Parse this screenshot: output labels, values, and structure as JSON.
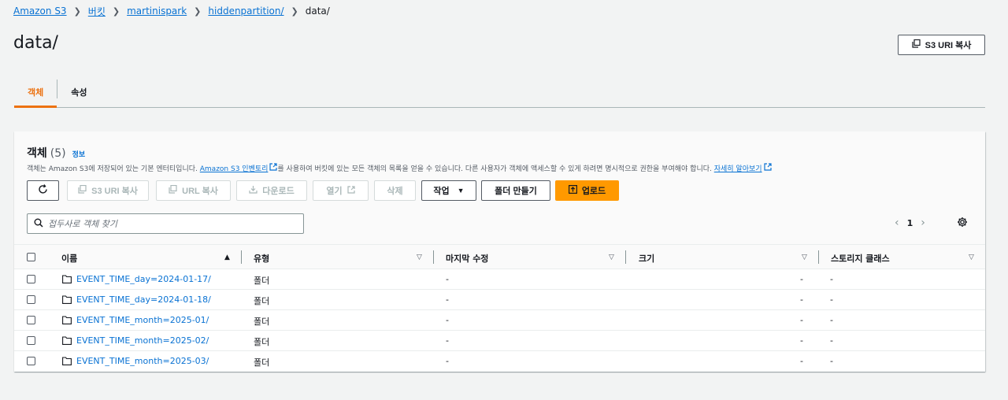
{
  "breadcrumb": [
    {
      "label": "Amazon S3"
    },
    {
      "label": "버킷"
    },
    {
      "label": "martinispark"
    },
    {
      "label": "hiddenpartition/"
    }
  ],
  "breadcrumb_current": "data/",
  "title": "data/",
  "copy_uri_top": "S3 URI 복사",
  "tabs": [
    {
      "label": "객체",
      "active": true
    },
    {
      "label": "속성",
      "active": false
    }
  ],
  "panel": {
    "title": "객체",
    "count": "(5)",
    "info": "정보",
    "desc_1": "객체는 Amazon S3에 저장되어 있는 기본 엔터티입니다. ",
    "desc_link1": "Amazon S3 인벤토리",
    "desc_2": "를 사용하여 버킷에 있는 모든 객체의 목록을 얻을 수 있습니다. 다른 사용자가 객체에 액세스할 수 있게 하려면 명시적으로 권한을 부여해야 합니다. ",
    "desc_link2": "자세히 알아보기"
  },
  "toolbar": {
    "copy_s3_uri": "S3 URI 복사",
    "copy_url": "URL 복사",
    "download": "다운로드",
    "open": "열기",
    "delete": "삭제",
    "actions": "작업",
    "create_folder": "폴더 만들기",
    "upload": "업로드"
  },
  "search": {
    "placeholder": "접두사로 객체 찾기",
    "value": ""
  },
  "pagination": {
    "current": "1"
  },
  "columns": [
    "이름",
    "유형",
    "마지막 수정",
    "크기",
    "스토리지 클래스"
  ],
  "rows": [
    {
      "name": "EVENT_TIME_day=2024-01-17/",
      "type": "폴더",
      "modified": "-",
      "size": "-",
      "storage": "-"
    },
    {
      "name": "EVENT_TIME_day=2024-01-18/",
      "type": "폴더",
      "modified": "-",
      "size": "-",
      "storage": "-"
    },
    {
      "name": "EVENT_TIME_month=2025-01/",
      "type": "폴더",
      "modified": "-",
      "size": "-",
      "storage": "-"
    },
    {
      "name": "EVENT_TIME_month=2025-02/",
      "type": "폴더",
      "modified": "-",
      "size": "-",
      "storage": "-"
    },
    {
      "name": "EVENT_TIME_month=2025-03/",
      "type": "폴더",
      "modified": "-",
      "size": "-",
      "storage": "-"
    }
  ],
  "colors": {
    "link": "#0972d3",
    "accent": "#ec7211",
    "primary_button": "#ff9900"
  }
}
